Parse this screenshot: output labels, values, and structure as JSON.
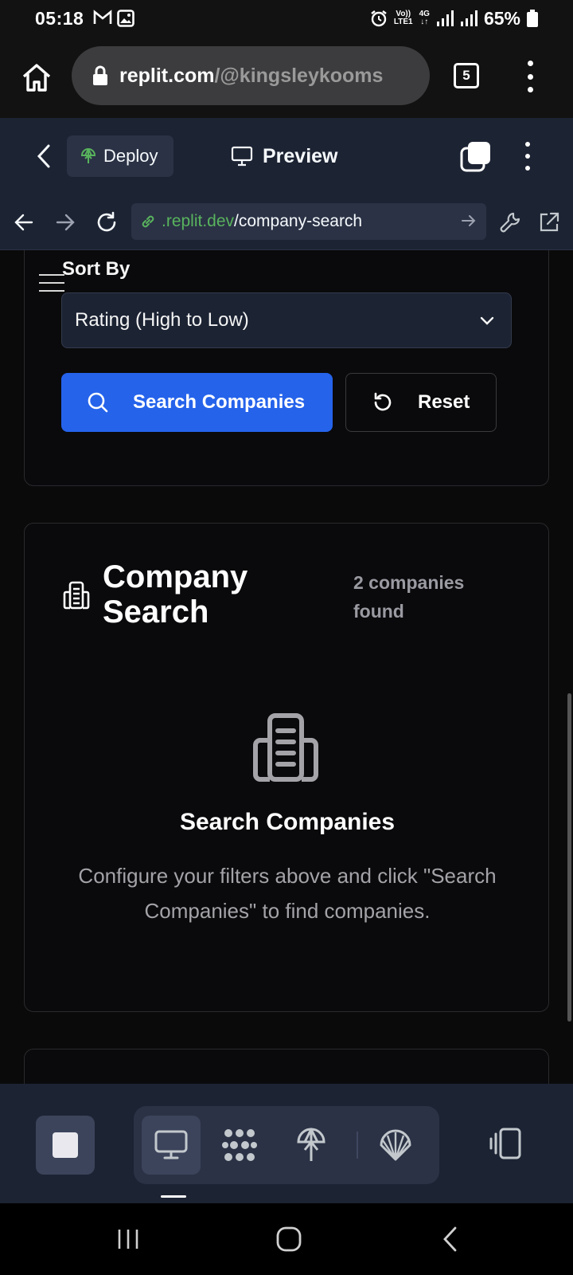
{
  "status_bar": {
    "time": "05:18",
    "network_top": "Vo))",
    "network_bottom": "LTE1",
    "network_type": "4G",
    "battery": "65%"
  },
  "browser": {
    "url_host": "replit.com",
    "url_path": "/@kingsleykooms",
    "tab_count": "5"
  },
  "replit": {
    "deploy_label": "Deploy",
    "preview_label": "Preview"
  },
  "webview": {
    "url_host": ".replit.dev",
    "url_path": "/company-search"
  },
  "filters": {
    "sort_label": "Sort By",
    "sort_value": "Rating (High to Low)",
    "search_button": "Search Companies",
    "reset_button": "Reset"
  },
  "results": {
    "title": "Company Search",
    "count": "2 companies found",
    "empty_title": "Search Companies",
    "empty_description": "Configure your filters above and click \"Search Companies\" to find companies."
  },
  "colors": {
    "accent": "#2563eb",
    "replit_bg": "#1c2333",
    "url_host_green": "#58b35d"
  }
}
